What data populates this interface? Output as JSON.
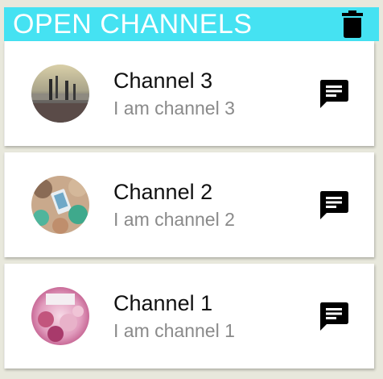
{
  "header": {
    "title": "OPEN CHANNELS",
    "accent_color": "#45e2f2",
    "action_icon": "trash-icon"
  },
  "channels": [
    {
      "name": "Channel 3",
      "description": "I am channel 3",
      "avatar": "beach-photo",
      "action_icon": "chat-icon"
    },
    {
      "name": "Channel 2",
      "description": "I am channel 2",
      "avatar": "friends-photo",
      "action_icon": "chat-icon"
    },
    {
      "name": "Channel 1",
      "description": "I am channel 1",
      "avatar": "party-photo",
      "action_icon": "chat-icon"
    }
  ]
}
